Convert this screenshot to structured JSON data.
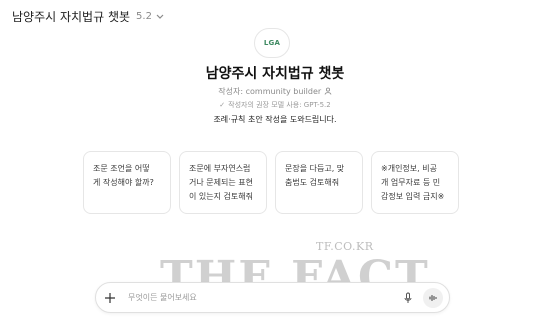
{
  "header": {
    "title": "남양주시 자치법규 챗봇",
    "version": "5.2"
  },
  "logo": {
    "text": "LGA"
  },
  "gpt": {
    "name": "남양주시 자치법규 챗봇",
    "author": "작성자: community builder",
    "creator_note": "작성자의 권장 모델 사용: GPT-5.2",
    "description": "조례·규칙 초안 작성을 도와드립니다."
  },
  "starters": [
    {
      "line1": "조문 조언을 어떻",
      "line2": "게 작성해야 할까?",
      "line3": ""
    },
    {
      "line1": "조문에 부자연스럽",
      "line2": "거나 문제되는 표현",
      "line3": "이 있는지 검토해줘"
    },
    {
      "line1": "문장을 다듬고, 맞",
      "line2": "춤법도 검토해줘",
      "line3": ""
    },
    {
      "line1": "※개인정보, 비공",
      "line2": "개 업무자료 등 민",
      "line3": "감정보 입력 금지※"
    }
  ],
  "composer": {
    "placeholder": "무엇이든 물어보세요"
  },
  "watermark": {
    "small": "TF.CO.KR",
    "large": "THE FACT"
  },
  "colors": {
    "accent": "#3f8a62",
    "border": "#e6e6e6"
  },
  "icons": [
    "chevron-down-icon",
    "person-icon",
    "check-icon",
    "plus-icon",
    "mic-icon",
    "voice-icon"
  ]
}
